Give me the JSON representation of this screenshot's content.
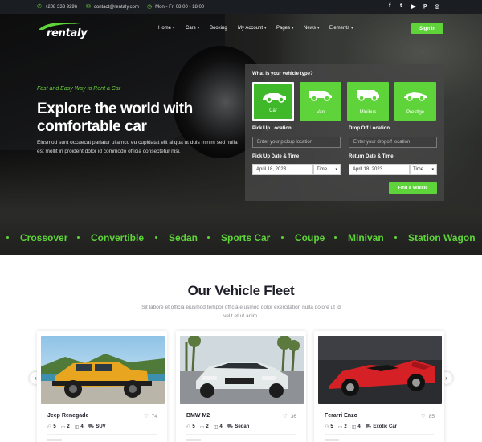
{
  "topbar": {
    "phone": "+208 333 9296",
    "email": "contact@rentaly.com",
    "hours": "Mon - Fri 08.00 - 18.00",
    "social": [
      "f",
      "t",
      "▶",
      "p",
      "◎"
    ]
  },
  "brand": {
    "name": "rentaly",
    "accent": "#5fd43a"
  },
  "nav": {
    "items": [
      {
        "label": "Home"
      },
      {
        "label": "Cars"
      },
      {
        "label": "Booking"
      },
      {
        "label": "My Account"
      },
      {
        "label": "Pages"
      },
      {
        "label": "News"
      },
      {
        "label": "Elements"
      }
    ],
    "signin": "Sign In"
  },
  "hero": {
    "tagline": "Fast and Easy Way to Rent a Car",
    "title": "Explore the world with comfortable car",
    "description": "Eiusmod sunt occaecat pariatur ullamco eu cupidatat elit aliqua ut duis minim sed nulla est mollit in proident dolor id commodo officia consectetur nisi."
  },
  "booking": {
    "title": "What is your vehicle type?",
    "vehicle_types": [
      {
        "label": "Car",
        "selected": true
      },
      {
        "label": "Van",
        "selected": false
      },
      {
        "label": "Minibus",
        "selected": false
      },
      {
        "label": "Prestige",
        "selected": false
      }
    ],
    "pickup_location_label": "Pick Up Location",
    "pickup_location_placeholder": "Enter your pickup location",
    "dropoff_location_label": "Drop Off Location",
    "dropoff_location_placeholder": "Enter your dropoff location",
    "pickup_datetime_label": "Pick Up Date & Time",
    "pickup_date": "April 18, 2023",
    "pickup_time": "Time",
    "return_datetime_label": "Return Date & Time",
    "return_date": "April 18, 2023",
    "return_time": "Time",
    "find_button": "Find a Vehicle"
  },
  "categories": [
    "Crossover",
    "Convertible",
    "Sedan",
    "Sports Car",
    "Coupe",
    "Minivan",
    "Station Wagon"
  ],
  "fleet": {
    "title": "Our Vehicle Fleet",
    "description": "Sit labore et officia eiusmod tempor officia eiusmod dolor exercitation nulla dolore ut id velit et ut anim.",
    "cars": [
      {
        "name": "Jeep Renegade",
        "likes": "74",
        "seats": "5",
        "bags": "2",
        "doors": "4",
        "type": "SUV"
      },
      {
        "name": "BMW M2",
        "likes": "36",
        "seats": "5",
        "bags": "2",
        "doors": "4",
        "type": "Sedan"
      },
      {
        "name": "Ferarri Enzo",
        "likes": "85",
        "seats": "5",
        "bags": "2",
        "doors": "4",
        "type": "Exotic Car"
      }
    ]
  }
}
